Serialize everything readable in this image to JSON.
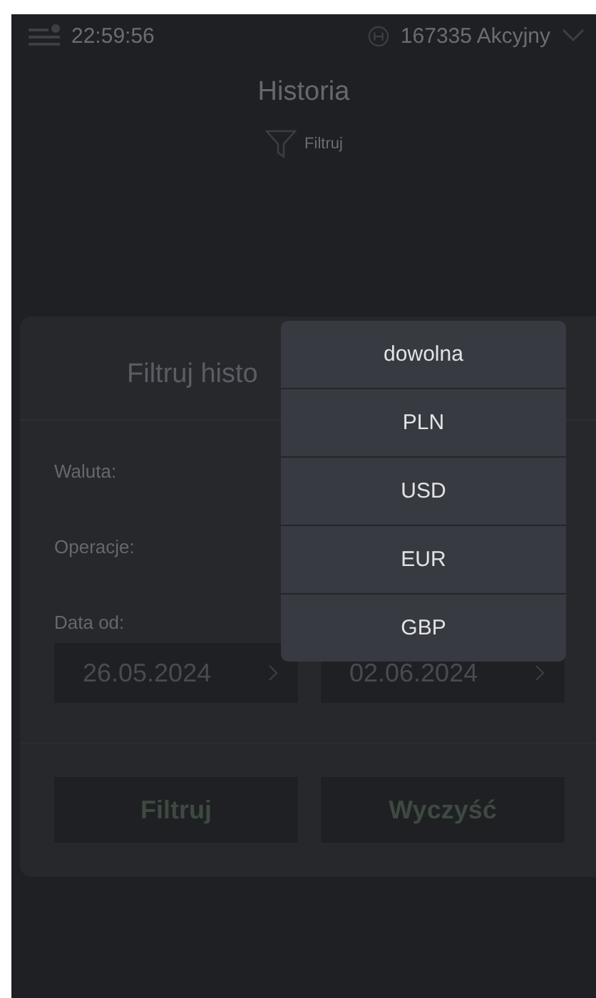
{
  "status_bar": {
    "time": "22:59:56",
    "account": "167335 Akcyjny"
  },
  "page": {
    "title": "Historia",
    "filter_link": "Filtruj"
  },
  "dialog": {
    "title": "Filtruj histo",
    "fields": [
      {
        "kind": "label",
        "label": "Waluta:"
      },
      {
        "kind": "label",
        "label": "Operacje:"
      },
      {
        "kind": "label",
        "label": "Data od:"
      }
    ],
    "dates": [
      "26.05.2024",
      "02.06.2024"
    ],
    "buttons": [
      {
        "label": "Filtruj",
        "kind": "primary"
      },
      {
        "label": "Wyczyść",
        "kind": "primary"
      }
    ]
  },
  "dropdown": {
    "options": [
      "dowolna",
      "PLN",
      "USD",
      "EUR",
      "GBP"
    ]
  }
}
